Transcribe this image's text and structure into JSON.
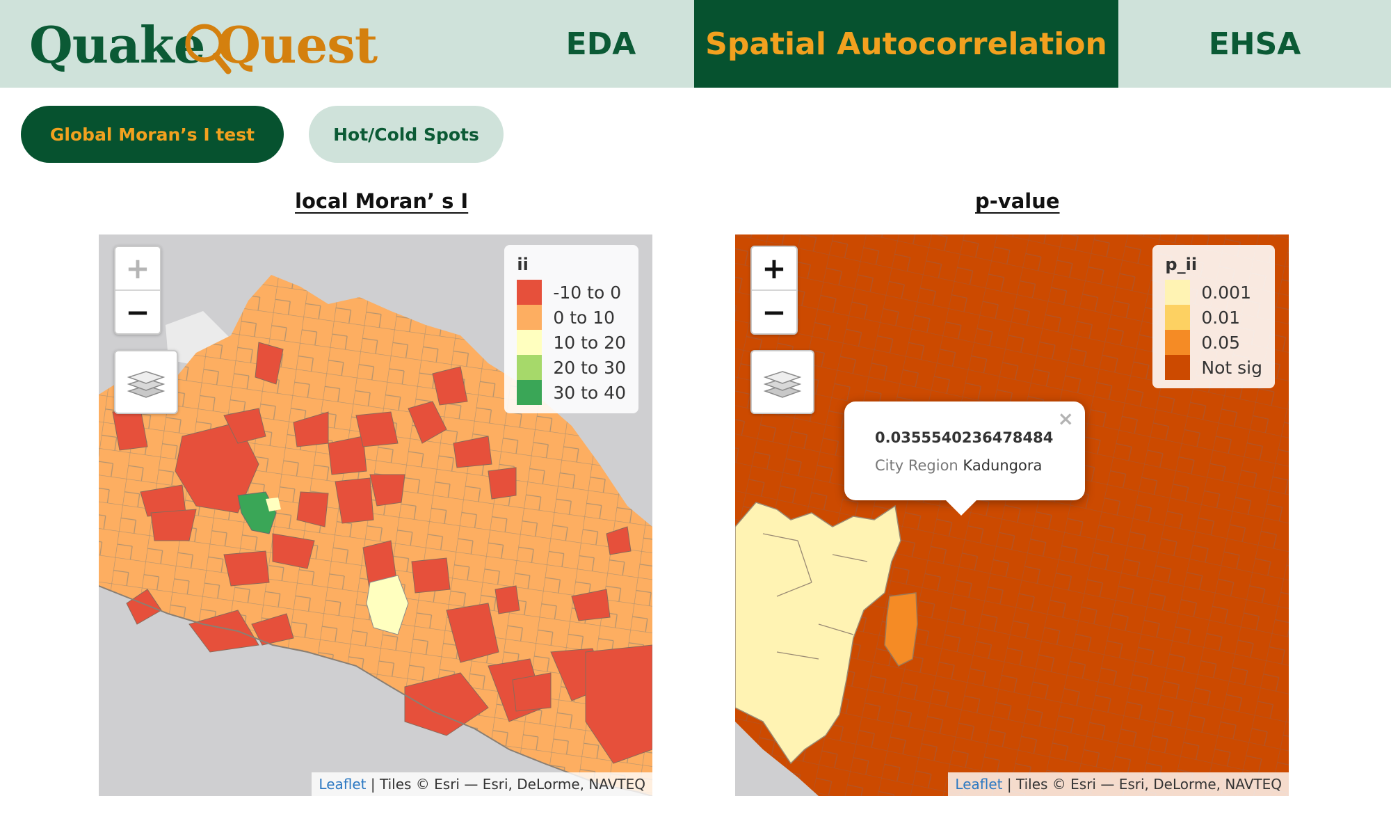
{
  "app": {
    "logo_part1": "Quake",
    "logo_part2": "Quest"
  },
  "nav": {
    "tabs": [
      {
        "label": "EDA",
        "active": false
      },
      {
        "label": "Spatial Autocorrelation",
        "active": true
      },
      {
        "label": "EHSA",
        "active": false
      }
    ]
  },
  "subtabs": [
    {
      "label": "Global Moran’s I test",
      "active": true
    },
    {
      "label": "Hot/Cold Spots",
      "active": false
    }
  ],
  "left_map": {
    "title": "local Moran’ s I",
    "zoom_in": "+",
    "zoom_out": "−",
    "legend": {
      "title": "ii",
      "items": [
        {
          "label": "-10 to 0",
          "color": "#e6503b"
        },
        {
          "label": "0 to 10",
          "color": "#fdae61"
        },
        {
          "label": "10 to 20",
          "color": "#ffffbf"
        },
        {
          "label": "20 to 30",
          "color": "#a6d96a"
        },
        {
          "label": "30 to 40",
          "color": "#3aa657"
        }
      ]
    },
    "attribution": {
      "link": "Leaflet",
      "text": " | Tiles © Esri — Esri, DeLorme, NAVTEQ"
    }
  },
  "right_map": {
    "title": "p-value",
    "zoom_in": "+",
    "zoom_out": "−",
    "legend": {
      "title": "p_ii",
      "items": [
        {
          "label": "0.001",
          "color": "#fff3b3"
        },
        {
          "label": "0.01",
          "color": "#fdd162"
        },
        {
          "label": "0.05",
          "color": "#f58b25"
        },
        {
          "label": "Not sig",
          "color": "#cc4a00"
        }
      ]
    },
    "popup": {
      "value": "0.0355540236478484",
      "key": "City Region",
      "name": "Kadungora",
      "close": "×"
    },
    "attribution": {
      "link": "Leaflet",
      "text": " | Tiles © Esri — Esri, DeLorme, NAVTEQ"
    }
  },
  "colors": {
    "primary_dark": "#06522f",
    "accent_orange": "#f2a11f",
    "light_green": "#cfe2da"
  },
  "icons": [
    "magnifier-icon",
    "layers-icon",
    "close-icon"
  ]
}
